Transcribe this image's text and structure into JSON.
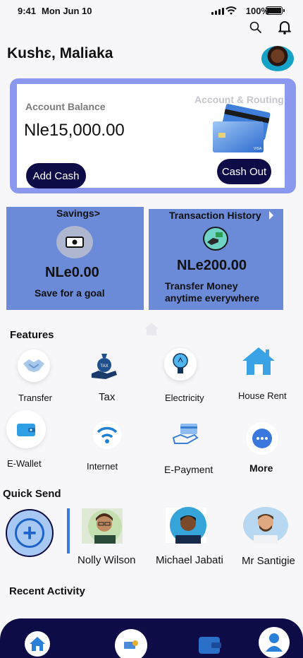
{
  "status": {
    "time": "9:41",
    "date": "Mon Jun 10",
    "battery": "100%"
  },
  "header": {
    "name": "Kushɛ, Maliaka"
  },
  "balance": {
    "label": "Account Balance",
    "amount": "Nle15,000.00",
    "routing_label": "Account & Routing",
    "add_cash": "Add Cash",
    "cash_out": "Cash Out"
  },
  "savings": {
    "title": "Savings>",
    "amount": "NLe0.00",
    "subtitle": "Save for a goal"
  },
  "history": {
    "title": "Transaction History",
    "amount": "NLe200.00",
    "subtitle_line1": "Transfer Money",
    "subtitle_line2": "anytime everywhere"
  },
  "features": {
    "title": "Features",
    "items": [
      {
        "label": "Transfer",
        "icon": "handshake-icon"
      },
      {
        "label": "Tax",
        "icon": "tax-bag-icon"
      },
      {
        "label": "Electricity",
        "icon": "lightbulb-icon"
      },
      {
        "label": "House Rent",
        "icon": "house-icon"
      },
      {
        "label": "E-Wallet",
        "icon": "wallet-icon"
      },
      {
        "label": "Internet",
        "icon": "wifi-icon"
      },
      {
        "label": "E-Payment",
        "icon": "card-hand-icon"
      },
      {
        "label": "More",
        "icon": "more-icon"
      }
    ]
  },
  "quick_send": {
    "title": "Quick Send",
    "people": [
      {
        "name": "Nolly Wilson"
      },
      {
        "name": "Michael Jabati"
      },
      {
        "name": "Mr Santigie"
      }
    ]
  },
  "recent": {
    "title": "Recent Activity"
  },
  "colors": {
    "accent": "#0e0c46",
    "tile": "#6b8ad8",
    "card_border": "#8b98f0"
  }
}
